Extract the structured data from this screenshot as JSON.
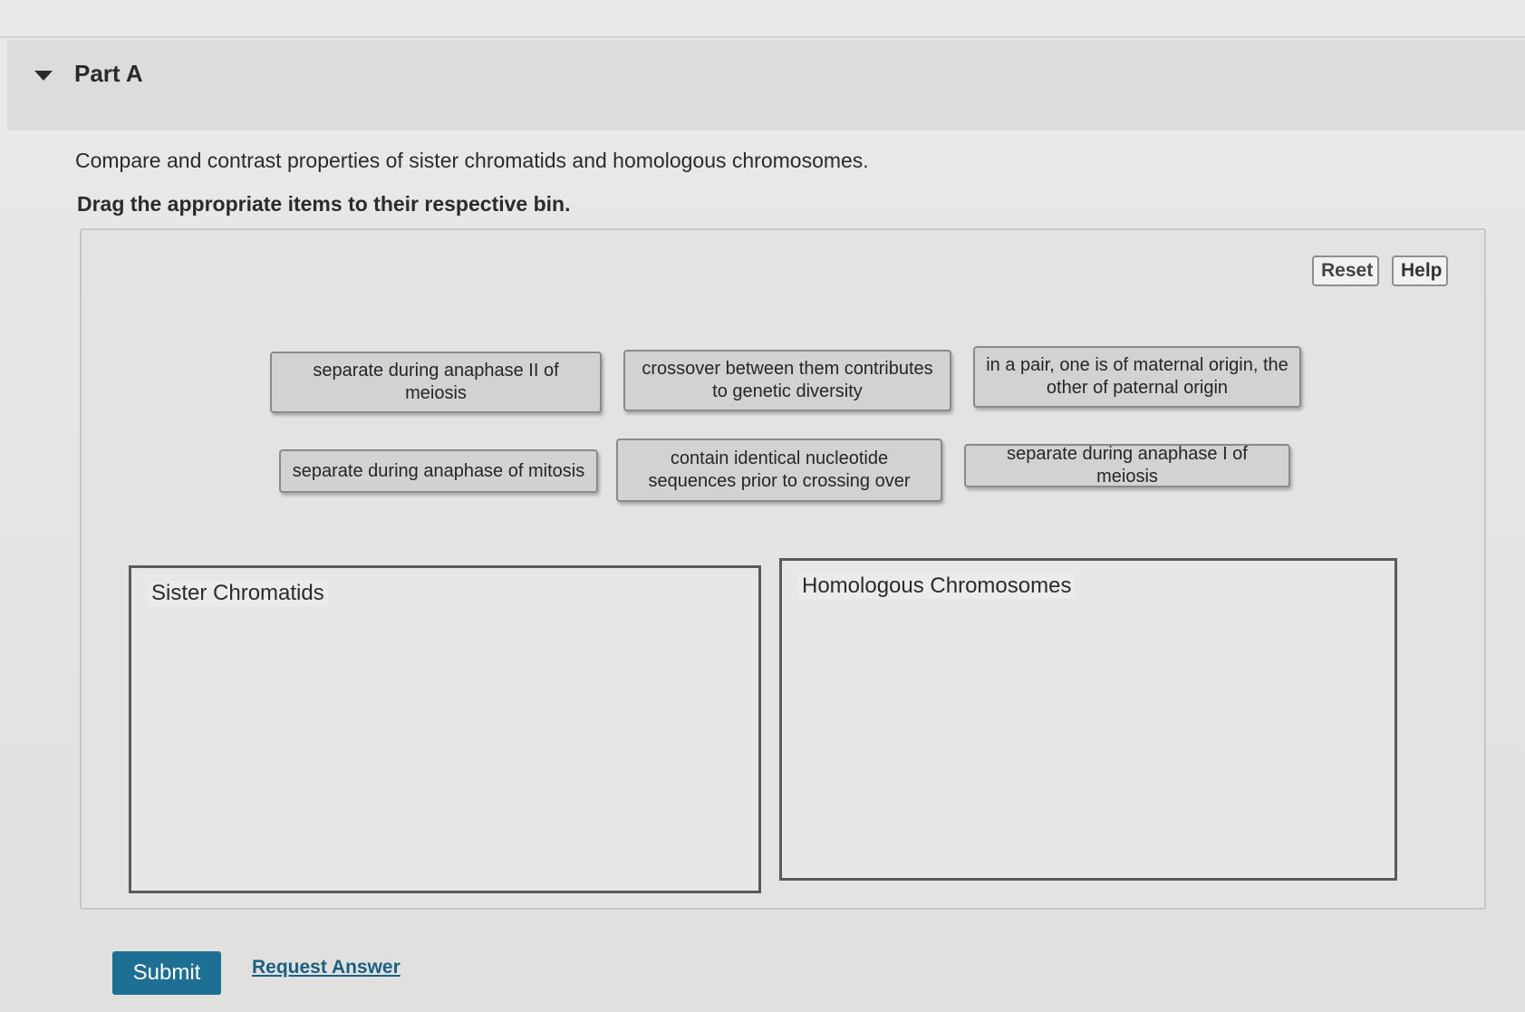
{
  "part": {
    "title": "Part A"
  },
  "question": {
    "prompt": "Compare and contrast properties of sister chromatids and homologous chromosomes.",
    "instruction": "Drag the appropriate items to their respective bin."
  },
  "toolbar": {
    "reset_label": "Reset",
    "help_label": "Help"
  },
  "items": [
    "separate during anaphase II of meiosis",
    "crossover between them contributes to genetic diversity",
    "in a pair, one is of maternal origin, the other of paternal origin",
    "separate during anaphase of mitosis",
    "contain identical nucleotide sequences prior to crossing over",
    "separate during anaphase I of meiosis"
  ],
  "bins": [
    {
      "label": "Sister Chromatids"
    },
    {
      "label": "Homologous Chromosomes"
    }
  ],
  "actions": {
    "submit_label": "Submit",
    "request_answer_label": "Request Answer"
  },
  "colors": {
    "submit_bg": "#1d6f93",
    "link": "#1d5f80"
  }
}
